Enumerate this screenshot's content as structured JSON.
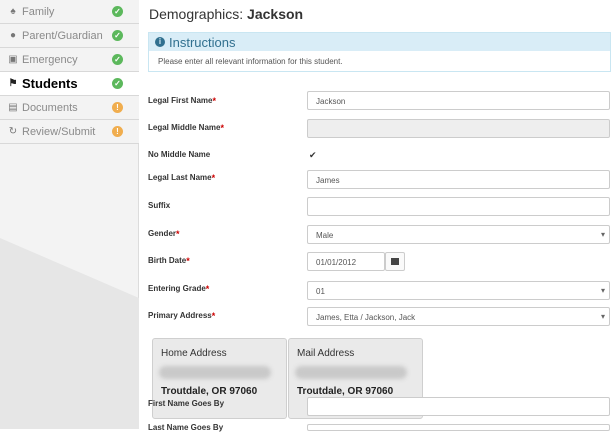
{
  "sidebar": {
    "items": [
      {
        "label": "Family",
        "icon": "users-icon",
        "status": "check",
        "status_color": "#5cb85c"
      },
      {
        "label": "Parent/Guardian",
        "icon": "user-icon",
        "status": "check",
        "status_color": "#5cb85c"
      },
      {
        "label": "Emergency",
        "icon": "id-card-icon",
        "status": "check",
        "status_color": "#5cb85c"
      },
      {
        "label": "Students",
        "icon": "graduation-cap-icon",
        "status": "check",
        "status_color": "#5cb85c",
        "active": true
      },
      {
        "label": "Documents",
        "icon": "file-icon",
        "status": "warning",
        "status_color": "#f0ad4e"
      },
      {
        "label": "Review/Submit",
        "icon": "refresh-icon",
        "status": "warning",
        "status_color": "#f0ad4e"
      }
    ]
  },
  "header": {
    "title_prefix": "Demographics: ",
    "title_name": "Jackson"
  },
  "instructions": {
    "heading": "Instructions",
    "text": "Please enter all relevant information for this student."
  },
  "form": {
    "legal_first_name": {
      "label": "Legal First Name",
      "value": "Jackson"
    },
    "legal_middle_name": {
      "label": "Legal Middle Name",
      "value": ""
    },
    "no_middle_name": {
      "label": "No Middle Name",
      "checked": true
    },
    "legal_last_name": {
      "label": "Legal Last Name",
      "value": "James"
    },
    "suffix": {
      "label": "Suffix",
      "value": ""
    },
    "gender": {
      "label": "Gender",
      "value": "Male"
    },
    "birth_date": {
      "label": "Birth Date",
      "value": "01/01/2012"
    },
    "entering_grade": {
      "label": "Entering Grade",
      "value": "01"
    },
    "primary_address": {
      "label": "Primary Address",
      "value": "James, Etta / Jackson, Jack"
    },
    "first_name_goes_by": {
      "label": "First Name Goes By",
      "value": ""
    },
    "last_name_goes_by": {
      "label": "Last Name Goes By",
      "value": ""
    }
  },
  "addresses": [
    {
      "title": "Home Address",
      "city": "Troutdale, OR 97060"
    },
    {
      "title": "Mail Address",
      "city": "Troutdale, OR 97060"
    }
  ],
  "colors": {
    "ok": "#5cb85c",
    "warning": "#f0ad4e",
    "info_bg": "#d9edf7",
    "info_text": "#31708f",
    "required": "#cc0000"
  }
}
